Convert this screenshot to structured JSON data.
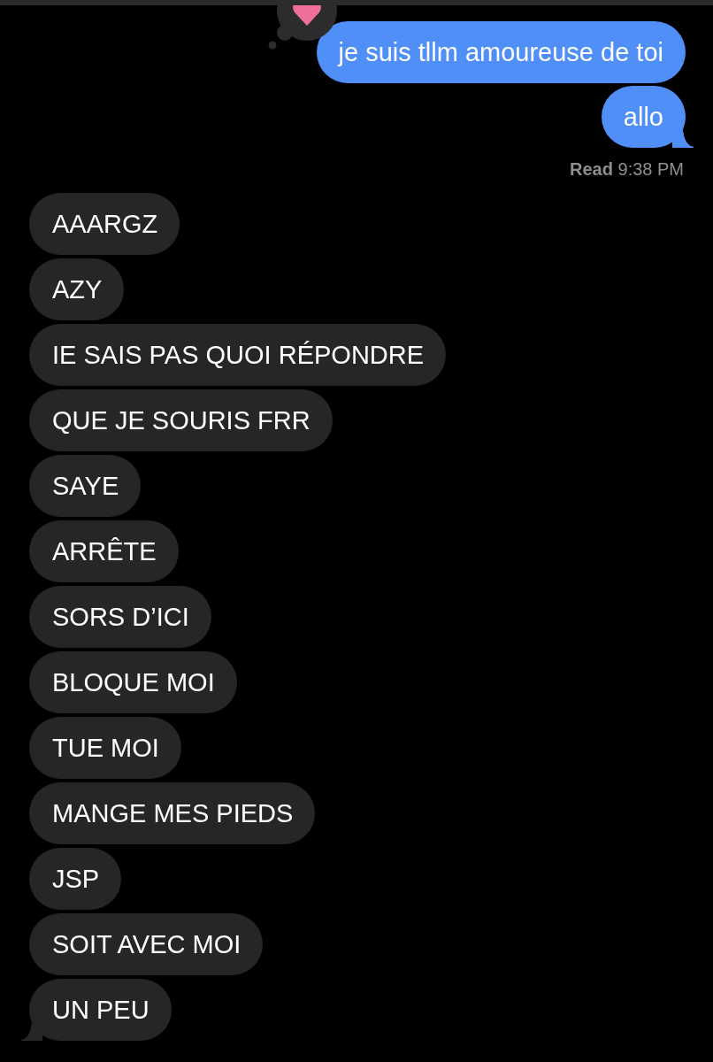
{
  "thread": [
    {
      "kind": "sent",
      "text": "je suis tllm amoureuse de toi",
      "tail": false,
      "reaction": true
    },
    {
      "kind": "sent",
      "text": "allo",
      "tail": true
    },
    {
      "kind": "receipt",
      "text": "**Read** 9:38 PM"
    },
    {
      "kind": "received",
      "text": "AAARGZ",
      "tail": false
    },
    {
      "kind": "received",
      "text": "AZY",
      "tail": false
    },
    {
      "kind": "received",
      "text": "IE SAIS PAS QUOI RÉPONDRE",
      "tail": false
    },
    {
      "kind": "received",
      "text": "QUE JE SOURIS FRR",
      "tail": false
    },
    {
      "kind": "received",
      "text": "SAYE",
      "tail": false
    },
    {
      "kind": "received",
      "text": "ARRÊTE",
      "tail": false
    },
    {
      "kind": "received",
      "text": "SORS D’ICI",
      "tail": false
    },
    {
      "kind": "received",
      "text": "BLOQUE MOI",
      "tail": false
    },
    {
      "kind": "received",
      "text": "TUE MOI",
      "tail": false
    },
    {
      "kind": "received",
      "text": "MANGE MES PIEDS",
      "tail": false
    },
    {
      "kind": "received",
      "text": "JSP",
      "tail": false
    },
    {
      "kind": "received",
      "text": "SOIT AVEC MOI",
      "tail": false
    },
    {
      "kind": "received",
      "text": "UN PEU",
      "tail": true
    }
  ]
}
